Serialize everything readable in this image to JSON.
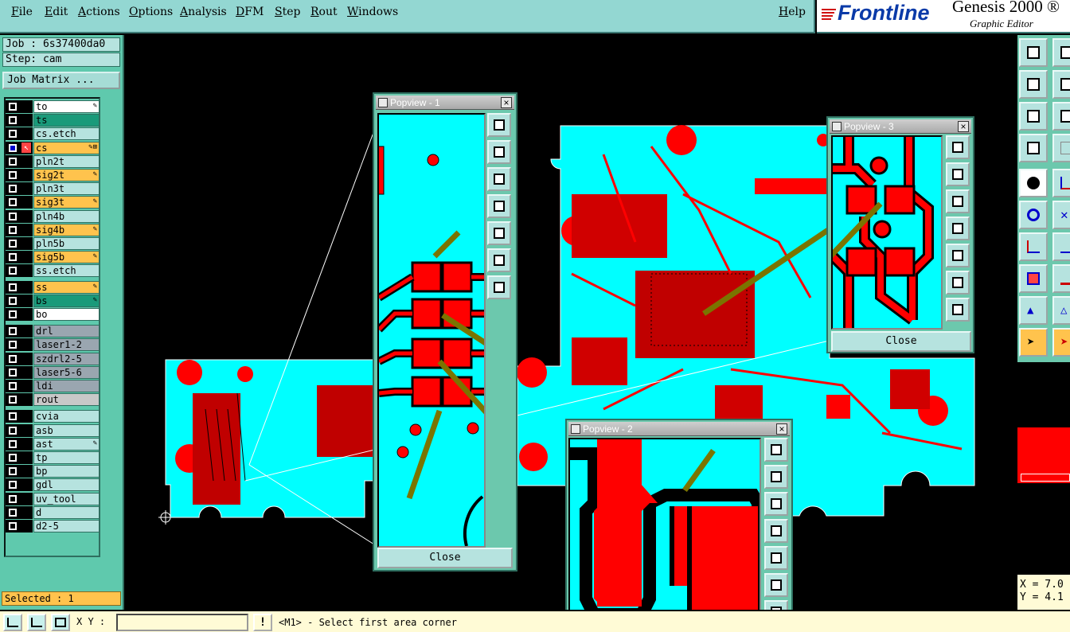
{
  "menu": [
    "File",
    "Edit",
    "Actions",
    "Options",
    "Analysis",
    "DFM",
    "Step",
    "Rout",
    "Windows"
  ],
  "help": "Help",
  "brand": {
    "logo": "Frontline",
    "product": "Genesis 2000 ®",
    "subtitle": "Graphic Editor"
  },
  "job": {
    "job_line": "Job : 6s37400da0",
    "step_line": "Step: cam",
    "matrix_button": "Job Matrix ..."
  },
  "layers": [
    {
      "name": "to",
      "color": "#ffffff",
      "icon": "✎"
    },
    {
      "name": "ts",
      "color": "#1a9a7a",
      "icon": ""
    },
    {
      "name": "cs.etch",
      "color": "#b6e3df",
      "icon": ""
    },
    {
      "name": "cs",
      "color": "#ffc34d",
      "icon": "✎⊞",
      "active": true
    },
    {
      "name": "pln2t",
      "color": "#b6e3df",
      "icon": ""
    },
    {
      "name": "sig2t",
      "color": "#ffc34d",
      "icon": "✎"
    },
    {
      "name": "pln3t",
      "color": "#b6e3df",
      "icon": ""
    },
    {
      "name": "sig3t",
      "color": "#ffc34d",
      "icon": "✎"
    },
    {
      "name": "pln4b",
      "color": "#b6e3df",
      "icon": ""
    },
    {
      "name": "sig4b",
      "color": "#ffc34d",
      "icon": "✎"
    },
    {
      "name": "pln5b",
      "color": "#b6e3df",
      "icon": ""
    },
    {
      "name": "sig5b",
      "color": "#ffc34d",
      "icon": "✎"
    },
    {
      "name": "ss.etch",
      "color": "#b6e3df",
      "icon": ""
    },
    {
      "name": "ss",
      "color": "#ffc34d",
      "icon": "✎"
    },
    {
      "name": "bs",
      "color": "#1a9a7a",
      "icon": "✎"
    },
    {
      "name": "bo",
      "color": "#ffffff",
      "icon": ""
    },
    {
      "name": "drl",
      "color": "#9aa6b0",
      "icon": ""
    },
    {
      "name": "laser1-2",
      "color": "#9aa6b0",
      "icon": ""
    },
    {
      "name": "szdrl2-5",
      "color": "#9aa6b0",
      "icon": ""
    },
    {
      "name": "laser5-6",
      "color": "#9aa6b0",
      "icon": ""
    },
    {
      "name": "ldi",
      "color": "#9aa6b0",
      "icon": ""
    },
    {
      "name": "rout",
      "color": "#c8c8c8",
      "icon": ""
    },
    {
      "name": "cvia",
      "color": "#b6e3df",
      "icon": ""
    },
    {
      "name": "asb",
      "color": "#b6e3df",
      "icon": ""
    },
    {
      "name": "ast",
      "color": "#b6e3df",
      "icon": "✎"
    },
    {
      "name": "tp",
      "color": "#b6e3df",
      "icon": ""
    },
    {
      "name": "bp",
      "color": "#b6e3df",
      "icon": ""
    },
    {
      "name": "gdl",
      "color": "#b6e3df",
      "icon": ""
    },
    {
      "name": "uv_tool",
      "color": "#b6e3df",
      "icon": ""
    },
    {
      "name": "d",
      "color": "#b6e3df",
      "icon": ""
    },
    {
      "name": "d2-5",
      "color": "#b6e3df",
      "icon": ""
    }
  ],
  "selected": "Selected : 1",
  "bottom": {
    "xy_label": "X Y :",
    "xy_value": "",
    "prompt": "<M1> - Select first area corner"
  },
  "popups": {
    "p1": {
      "title": "Popview - 1",
      "close": "Close"
    },
    "p2": {
      "title": "Popview - 2"
    },
    "p3": {
      "title": "Popview - 3",
      "close": "Close"
    }
  },
  "coords": {
    "x": "X = 7.0",
    "y": "Y = 4.1"
  },
  "colors": {
    "board": "#00ffff",
    "copper": "#ff0000",
    "panel": "#6cc8ad",
    "arrow": "#7a7400"
  }
}
